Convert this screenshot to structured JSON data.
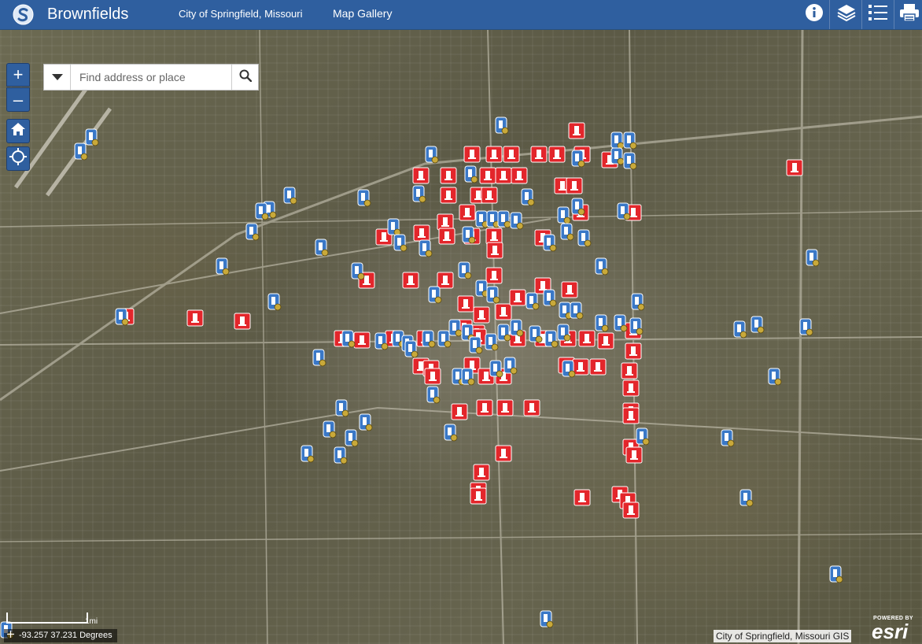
{
  "header": {
    "title": "Brownfields",
    "subtitle": "City of Springfield, Missouri",
    "gallery_link": "Map Gallery",
    "logo_icon": "city-logo-icon",
    "buttons": [
      "info-icon",
      "layers-icon",
      "legend-icon",
      "print-icon"
    ],
    "background_color": "#2f5f9f"
  },
  "search": {
    "placeholder": "Find address or place",
    "value": ""
  },
  "map_controls": {
    "zoom_in": "+",
    "zoom_out": "–",
    "home_icon": "home-icon",
    "locate_icon": "locate-icon"
  },
  "scalebar": {
    "label": "1mi"
  },
  "coordinates": {
    "text": "-93.257 37.231 Degrees"
  },
  "attribution": "City of Springfield, Missouri GIS",
  "esri": {
    "powered_by": "POWERED BY",
    "logo_text": "esri"
  },
  "legend_colors": {
    "red_marker": "#e3262b",
    "blue_marker": "#3a78c7",
    "blue_badge": "#c9a93a"
  }
}
